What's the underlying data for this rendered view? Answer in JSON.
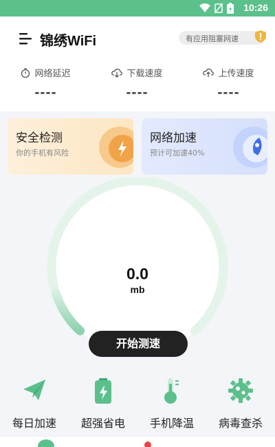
{
  "status_bar": {
    "time": "10:26"
  },
  "header": {
    "app_title": "锦绣WiFi",
    "alert_text": "有应用阻塞网速"
  },
  "metrics": [
    {
      "label": "网络延迟",
      "value": "----",
      "icon": "timer-icon"
    },
    {
      "label": "下载速度",
      "value": "----",
      "icon": "cloud-download-icon"
    },
    {
      "label": "上传速度",
      "value": "----",
      "icon": "cloud-upload-icon"
    }
  ],
  "cards": {
    "security": {
      "title": "安全检测",
      "subtitle": "你的手机有风险"
    },
    "boost": {
      "title": "网络加速",
      "subtitle": "预计可加速40%"
    }
  },
  "gauge": {
    "value": "0.0",
    "unit": "mb"
  },
  "start_button": {
    "label": "开始测速"
  },
  "tools": [
    {
      "label": "每日加速",
      "icon": "paper-plane-icon"
    },
    {
      "label": "超强省电",
      "icon": "battery-icon"
    },
    {
      "label": "手机降温",
      "icon": "thermometer-icon"
    },
    {
      "label": "病毒查杀",
      "icon": "virus-gear-icon"
    }
  ],
  "colors": {
    "accent": "#5cc08c",
    "gauge_track": "#e4f4ea",
    "gauge_fill": "#8fd1ad",
    "button": "#222222"
  }
}
